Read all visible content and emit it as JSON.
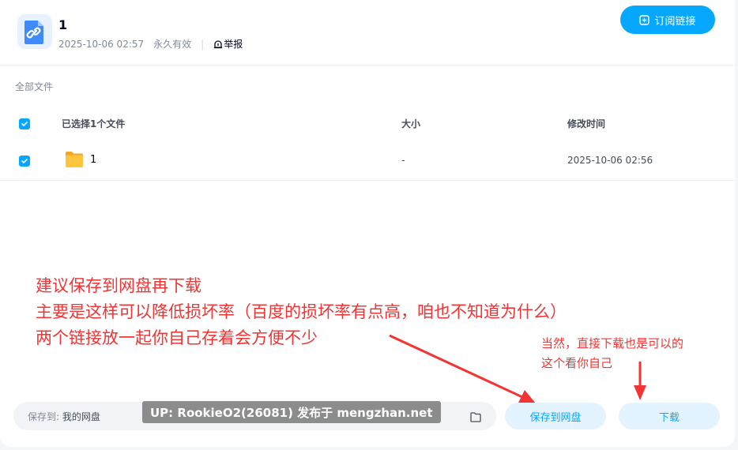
{
  "header": {
    "title": "1",
    "date": "2025-10-06 02:57",
    "validity": "永久有效",
    "separator": "|",
    "report_label": "举报",
    "subscribe_label": "订阅链接"
  },
  "breadcrumb": "全部文件",
  "table": {
    "columns": [
      "已选择1个文件",
      "大小",
      "修改时间"
    ],
    "rows": [
      {
        "name": "1",
        "size": "-",
        "modified": "2025-10-06 02:56"
      }
    ]
  },
  "annotations": {
    "main_lines": [
      "建议保存到网盘再下载",
      "主要是这样可以降低损坏率（百度的损坏率有点高，咱也不知道为什么）",
      "两个链接放一起你自己存着会方便不少"
    ],
    "side_lines": [
      "当然，直接下载也是可以的",
      "这个看你自己"
    ]
  },
  "footer": {
    "save_to_label": "保存到:",
    "save_to_target": "我的网盘",
    "watermark": "UP: RookieO2(26081) 发布于 mengzhan.net",
    "save_button": "保存到网盘",
    "download_button": "下载"
  },
  "colors": {
    "accent": "#06a7ff",
    "annotation": "#f23434",
    "folder": "#ffc53d"
  },
  "icons": [
    "link-icon",
    "report-icon",
    "subscribe-plus-icon",
    "check-icon",
    "folder-icon",
    "folder-outline-icon"
  ]
}
